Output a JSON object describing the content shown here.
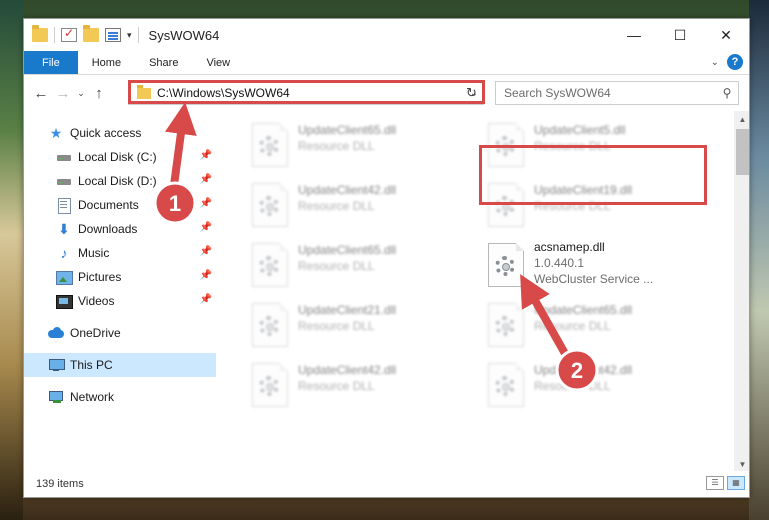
{
  "window": {
    "title": "SysWOW64",
    "controls": {
      "minimize": "—",
      "maximize": "☐",
      "close": "✕"
    }
  },
  "ribbon": {
    "tabs": [
      {
        "label": "File"
      },
      {
        "label": "Home"
      },
      {
        "label": "Share"
      },
      {
        "label": "View"
      }
    ],
    "help": "?"
  },
  "nav": {
    "back": "←",
    "forward": "→",
    "recent": "⌄",
    "up": "↑",
    "address": "C:\\Windows\\SysWOW64",
    "refresh": "↻",
    "search_placeholder": "Search SysWOW64"
  },
  "sidebar": {
    "quick_access": "Quick access",
    "items": [
      {
        "label": "Local Disk (C:)"
      },
      {
        "label": "Local Disk (D:)"
      },
      {
        "label": "Documents"
      },
      {
        "label": "Downloads"
      },
      {
        "label": "Music"
      },
      {
        "label": "Pictures"
      },
      {
        "label": "Videos"
      }
    ],
    "onedrive": "OneDrive",
    "this_pc": "This PC",
    "network": "Network"
  },
  "files": [
    {
      "name": "UpdateClient65.dll",
      "meta": "Resource DLL"
    },
    {
      "name": "UpdateClient5.dll",
      "meta": "Resource DLL"
    },
    {
      "name": "UpdateClient42.dll",
      "meta": "Resource DLL"
    },
    {
      "name": "UpdateClient19.dll",
      "meta": "Resource DLL"
    },
    {
      "name": "UpdateClient65.dll",
      "meta": "Resource DLL"
    },
    {
      "name": "acsnamep.dll",
      "version": "1.0.440.1",
      "description": "WebCluster Service ..."
    },
    {
      "name": "UpdateClient21.dll",
      "meta": "Resource DLL"
    },
    {
      "name": "UpdateClient65.dll",
      "meta": "Resource DLL"
    },
    {
      "name": "UpdateClient42.dll",
      "meta": "Resource DLL"
    },
    {
      "name": "UpdateClient42.dll",
      "meta": "Resource DLL"
    }
  ],
  "status": {
    "item_count": "139 items"
  },
  "annotations": {
    "step1": "1",
    "step2": "2",
    "color": "#d84a4a"
  }
}
